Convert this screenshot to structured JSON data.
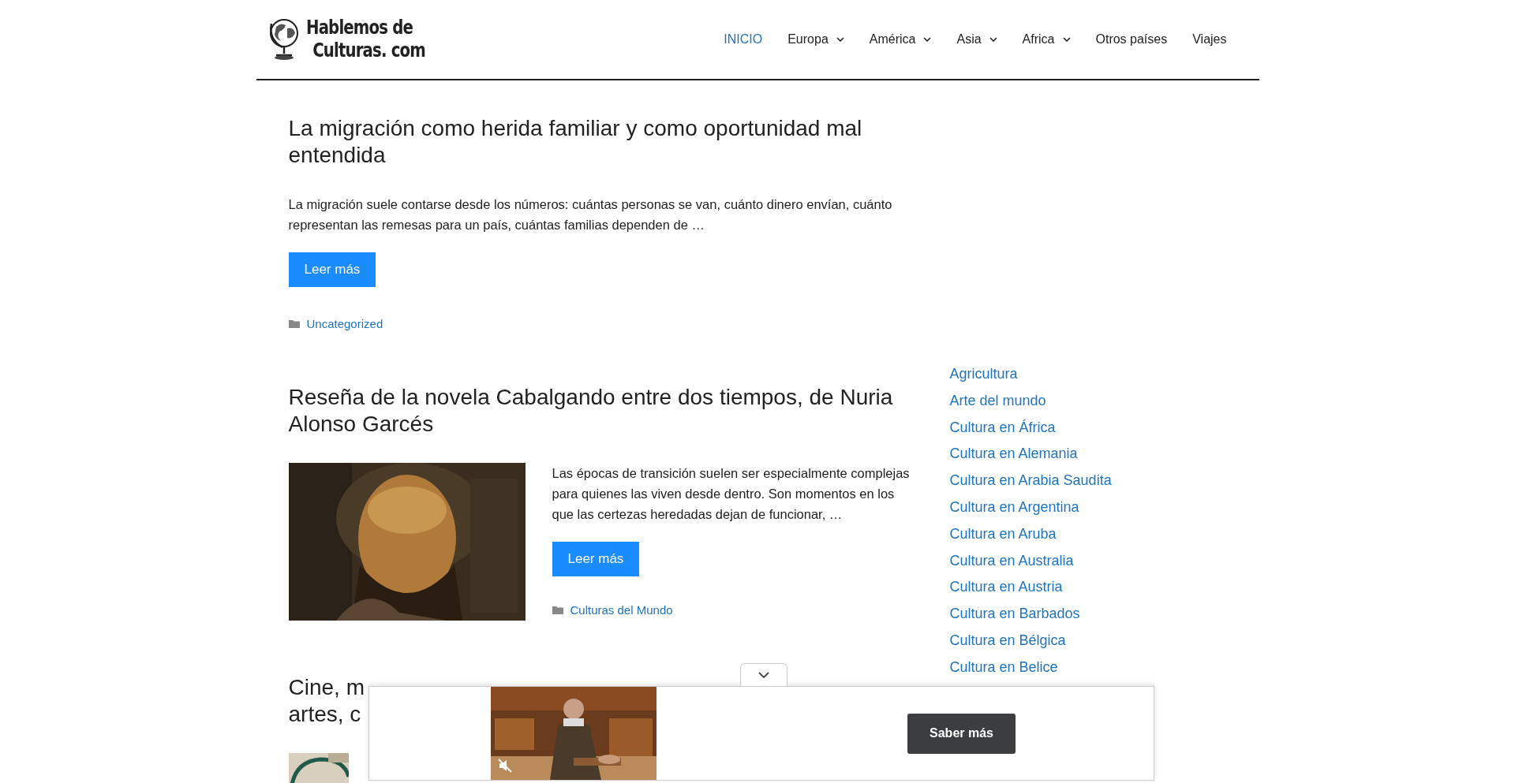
{
  "header": {
    "logo_line_1": "Hablemos de",
    "logo_line_2": "Culturas. com",
    "nav": [
      {
        "label": "INICIO",
        "selected": true,
        "dropdown": false
      },
      {
        "label": "Europa",
        "selected": false,
        "dropdown": true
      },
      {
        "label": "América",
        "selected": false,
        "dropdown": true
      },
      {
        "label": "Asia",
        "selected": false,
        "dropdown": true
      },
      {
        "label": "Africa",
        "selected": false,
        "dropdown": true
      },
      {
        "label": "Otros países",
        "selected": false,
        "dropdown": false
      },
      {
        "label": "Viajes",
        "selected": false,
        "dropdown": false
      }
    ]
  },
  "posts": [
    {
      "kind": "text",
      "title": "La migración como herida familiar y como oportunidad mal entendida",
      "excerpt": "La migración suele contarse desde los números: cuántas personas se van, cuánto dinero envían, cuánto representan las remesas para un país, cuántas familias dependen de …",
      "button": "Leer más",
      "category": "Uncategorized"
    },
    {
      "title": "Reseña de la novela Cabalgando entre dos tiempos, de Nuria Alonso Garcés",
      "excerpt": "Las épocas de transición suelen ser especialmente complejas para quienes las viven desde dentro. Son momentos en los que las certezas heredadas dejan de funcionar, …",
      "button": "Leer más",
      "category": "Culturas del Mundo"
    },
    {
      "kind": "covered",
      "title": "Cine, m\nartes, c"
    }
  ],
  "sidebar": {
    "categories": [
      "Agricultura",
      "Arte del mundo",
      "Cultura en África",
      "Cultura en Alemania",
      "Cultura en Arabia Saudita",
      "Cultura en Argentina",
      "Cultura en Aruba",
      "Cultura en Australia",
      "Cultura en Austria",
      "Cultura en Barbados",
      "Cultura en Bélgica",
      "Cultura en Belice"
    ]
  },
  "ad_banner": {
    "video": {
      "kind": "picture",
      "muted": true
    },
    "button": "Saber más"
  }
}
